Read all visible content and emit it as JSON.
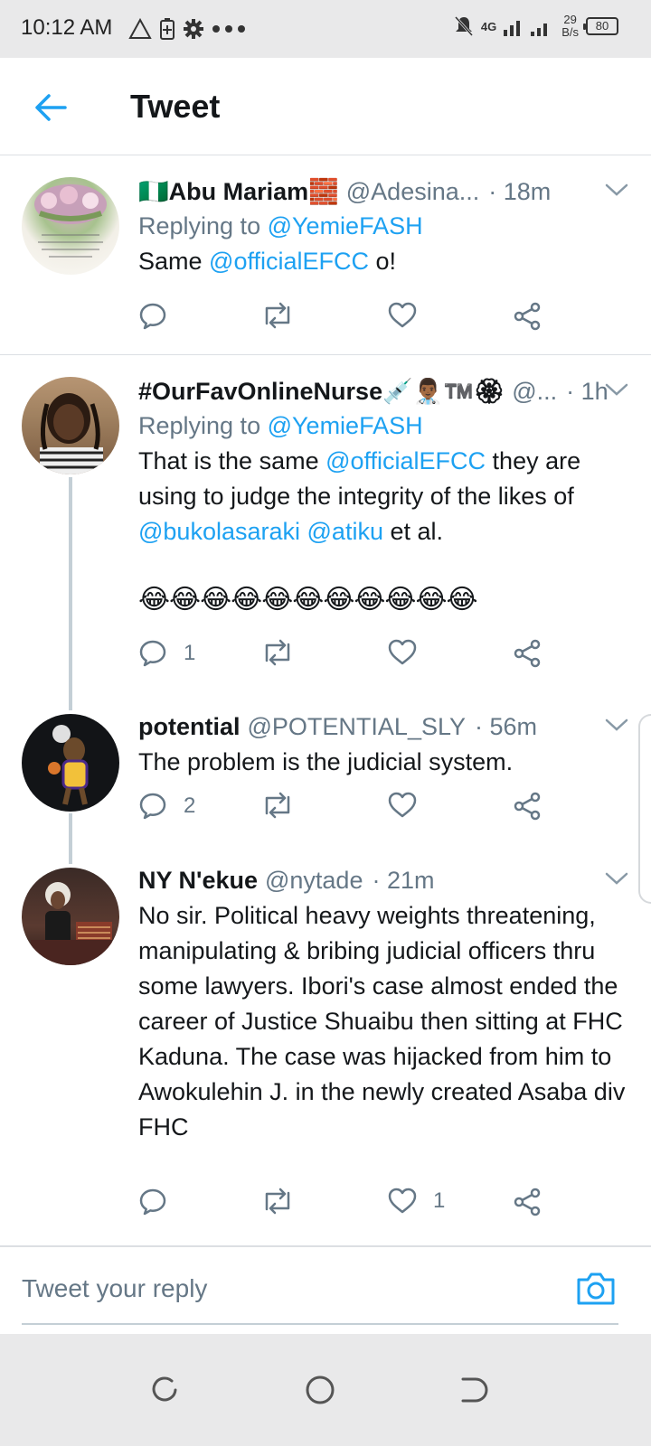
{
  "status_bar": {
    "time": "10:12 AM",
    "net_speed_value": "29",
    "net_speed_unit": "B/s",
    "network": "4G",
    "battery": "80"
  },
  "header": {
    "title": "Tweet"
  },
  "tweets": [
    {
      "name": "🇳🇬Abu Mariam🧱",
      "handle": "@Adesina...",
      "time": "· 18m",
      "replying_prefix": "Replying to",
      "replying_to": "@YemieFASH",
      "body_pre": "Same ",
      "body_mention": "@officialEFCC",
      "body_post": " o!",
      "replies": "",
      "likes": ""
    },
    {
      "name": "#OurFavOnlineNurse💉👨🏾‍⚕️™️🏵",
      "handle": "@...",
      "time": "· 1h",
      "replying_prefix": "Replying to",
      "replying_to": "@YemieFASH",
      "body_1": "That is the same ",
      "body_mention_1": "@officialEFCC",
      "body_2": " they are using to judge the integrity of the likes of ",
      "body_mention_2": "@bukolasaraki",
      "body_3": " ",
      "body_mention_3": "@atiku",
      "body_4": " et al.",
      "emoji_line": "😂😂😂😂😂😂😂😂😂😂😂",
      "replies": "1",
      "likes": ""
    },
    {
      "name": "potential",
      "handle": "@POTENTIAL_SLY",
      "time": "· 56m",
      "body": "The problem is the judicial system.",
      "replies": "2",
      "likes": ""
    },
    {
      "name": "NY N'ekue",
      "handle": "@nytade",
      "time": "· 21m",
      "body": "No sir. Political heavy weights threatening, manipulating & bribing judicial officers thru some lawyers. Ibori's case almost ended the career of Justice Shuaibu then sitting at FHC Kaduna. The case was hijacked from him to Awokulehin J. in the newly created Asaba div FHC",
      "replies": "",
      "likes": "1"
    }
  ],
  "reply_bar": {
    "placeholder": "Tweet your reply"
  },
  "icons": {
    "back": "arrow-left-icon",
    "caret": "chevron-down-icon",
    "reply": "comment-icon",
    "retweet": "retweet-icon",
    "like": "heart-icon",
    "share": "share-icon",
    "camera": "camera-icon"
  },
  "colors": {
    "accent": "#1da1f2",
    "secondary_text": "#657786",
    "primary_text": "#14171a"
  }
}
